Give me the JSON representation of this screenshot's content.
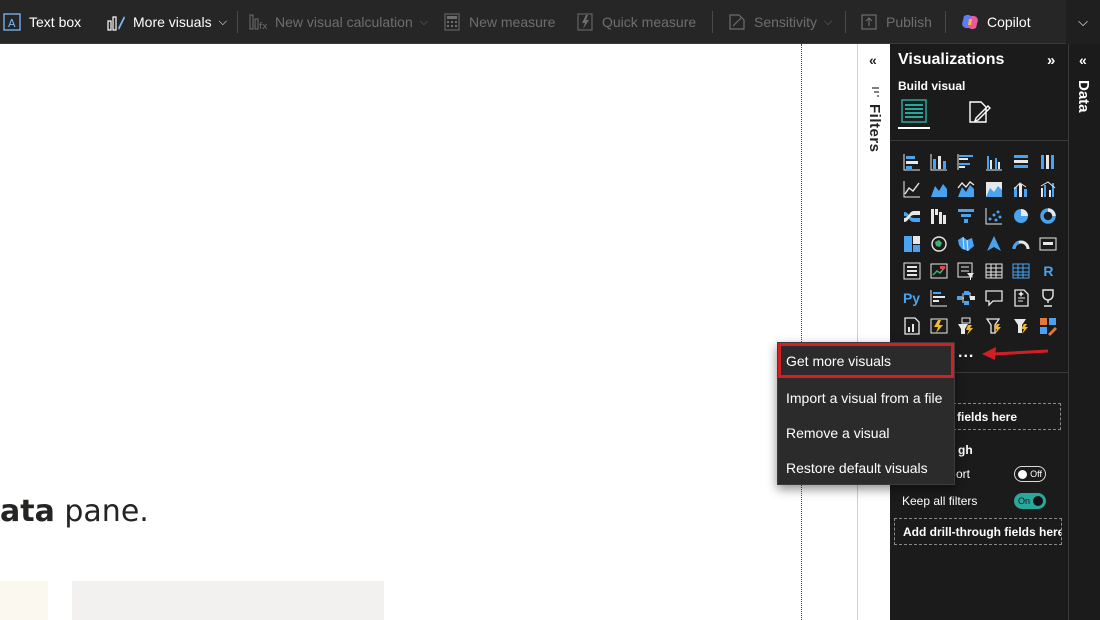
{
  "ribbon": {
    "text_box": "Text box",
    "more_visuals": "More visuals",
    "new_visual_calculation": "New visual calculation",
    "new_measure": "New measure",
    "quick_measure": "Quick measure",
    "sensitivity": "Sensitivity",
    "publish": "Publish",
    "copilot": "Copilot"
  },
  "canvas": {
    "text_bold": "ata",
    "text_rest": " pane."
  },
  "filters_pane": {
    "label": "Filters"
  },
  "visualizations": {
    "title": "Visualizations",
    "build_visual_label": "Build visual",
    "more_dots": "...",
    "drop_fields_partial": "fields here",
    "drill_through_partial": "gh",
    "cross_report_partial": "ort",
    "cross_report_state": "Off",
    "keep_all_filters_label": "Keep all filters",
    "keep_all_filters_state": "On",
    "drill_through_drop": "Add drill-through fields here",
    "icons": [
      "stacked-bar-chart",
      "stacked-column-chart",
      "clustered-bar-chart",
      "clustered-column-chart",
      "100-stacked-bar-chart",
      "100-stacked-column-chart",
      "line-chart",
      "area-chart",
      "stacked-area-chart",
      "100-stacked-area-chart",
      "line-and-stacked-column-chart",
      "line-and-clustered-column-chart",
      "ribbon-chart",
      "waterfall-chart",
      "funnel-chart",
      "scatter-chart",
      "pie-chart",
      "donut-chart",
      "treemap",
      "map",
      "filled-map",
      "azure-map",
      "gauge",
      "card",
      "multi-row-card",
      "kpi",
      "slicer",
      "table",
      "matrix",
      "r-script-visual",
      "python-visual",
      "key-influencers",
      "decomposition-tree",
      "qa-visual",
      "smart-narrative",
      "metrics",
      "paginated-report",
      "power-apps",
      "power-automate",
      "power-automate-alt",
      "power-automate-2",
      "custom-visual"
    ]
  },
  "data_pane": {
    "label": "Data"
  },
  "context_menu": {
    "items": [
      "Get more visuals",
      "Import a visual from a file",
      "Remove a visual",
      "Restore default visuals"
    ]
  },
  "colors": {
    "ribbon_bg": "#262626",
    "pane_bg": "#1b1b1b",
    "accent_blue": "#4aa3f0",
    "highlight_red": "#d21f26",
    "toggle_on": "#2aa79b"
  }
}
